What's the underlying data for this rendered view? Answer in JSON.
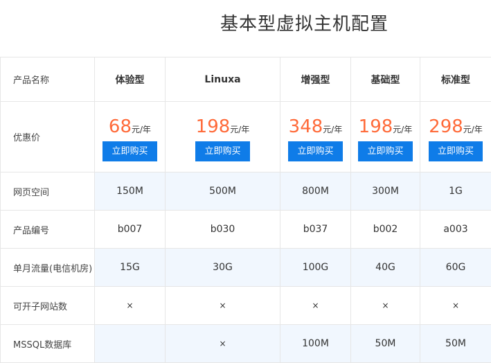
{
  "title": "基本型虚拟主机配置",
  "table": {
    "header_label": "产品名称",
    "plans": [
      "体验型",
      "Linuxa",
      "增强型",
      "基础型",
      "标准型"
    ],
    "price_label": "优惠价",
    "prices": [
      "68",
      "198",
      "348",
      "198",
      "298"
    ],
    "price_unit": "元/年",
    "buy_label": "立即购买",
    "rows": [
      {
        "label": "网页空间",
        "values": [
          "150M",
          "500M",
          "800M",
          "300M",
          "1G"
        ]
      },
      {
        "label": "产品编号",
        "values": [
          "b007",
          "b030",
          "b037",
          "b002",
          "a003"
        ]
      },
      {
        "label": "单月流量(电信机房)",
        "values": [
          "15G",
          "30G",
          "100G",
          "40G",
          "60G"
        ]
      },
      {
        "label": "可开子网站数",
        "values": [
          "×",
          "×",
          "×",
          "×",
          "×"
        ]
      },
      {
        "label": "MSSQL数据库",
        "values": [
          "",
          "×",
          "100M",
          "50M",
          "50M"
        ]
      }
    ]
  }
}
